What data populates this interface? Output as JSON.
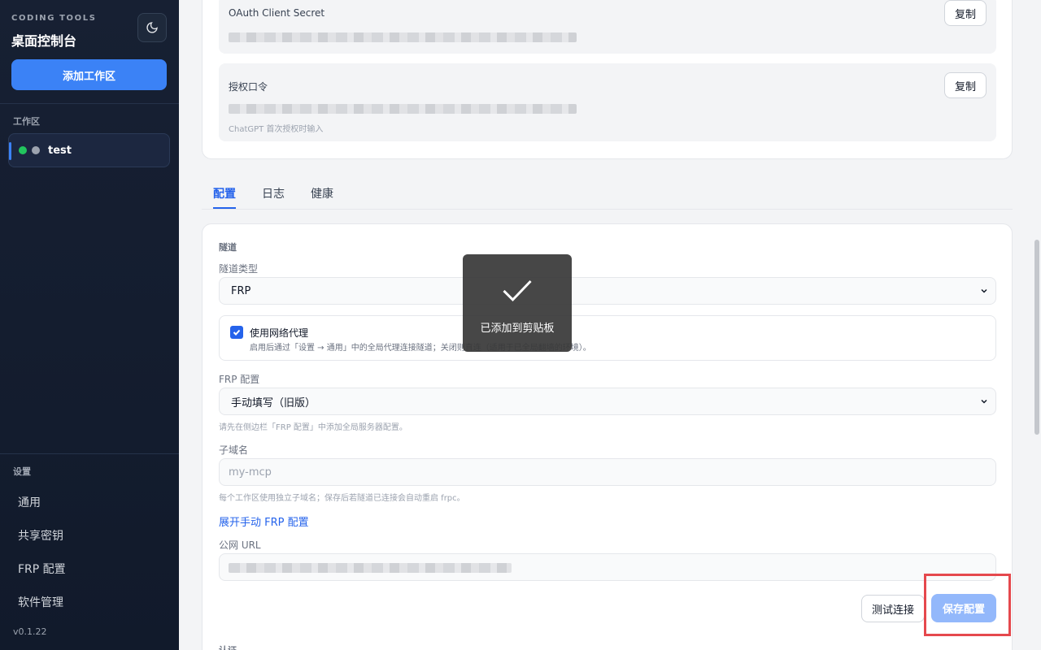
{
  "sidebar": {
    "brand_sub": "CODING TOOLS",
    "brand_title": "桌面控制台",
    "add_workspace": "添加工作区",
    "workspace_section": "工作区",
    "workspace": {
      "name": "test"
    },
    "settings_section": "设置",
    "nav": [
      "通用",
      "共享密钥",
      "FRP 配置",
      "软件管理"
    ],
    "version": "v0.1.22"
  },
  "top_card": {
    "client_secret_label": "OAuth Client Secret",
    "auth_token_label": "授权口令",
    "auth_token_hint": "ChatGPT 首次授权时输入",
    "copy_label": "复制"
  },
  "tabs": [
    "配置",
    "日志",
    "健康"
  ],
  "config": {
    "section_tunnel": "隧道",
    "tunnel_type_label": "隧道类型",
    "tunnel_type_value": "FRP",
    "proxy_title": "使用网络代理",
    "proxy_desc": "启用后通过「设置 → 通用」中的全局代理连接隧道；关闭则直连（适用于已全局翻墙的环境）。",
    "frp_config_label": "FRP 配置",
    "frp_config_value": "手动填写（旧版）",
    "frp_config_hint": "请先在侧边栏「FRP 配置」中添加全局服务器配置。",
    "subdomain_label": "子域名",
    "subdomain_placeholder": "my-mcp",
    "subdomain_hint": "每个工作区使用独立子域名；保存后若隧道已连接会自动重启 frpc。",
    "expand_link": "展开手动 FRP 配置",
    "public_url_label": "公网 URL",
    "test_button": "测试连接",
    "save_button": "保存配置",
    "section_auth": "认证"
  },
  "toast": {
    "text": "已添加到剪贴板"
  },
  "colors": {
    "accent": "#3b82f6",
    "sidebar_bg": "#172033",
    "save_disabled": "#93b8fb",
    "highlight": "#e5484d"
  }
}
